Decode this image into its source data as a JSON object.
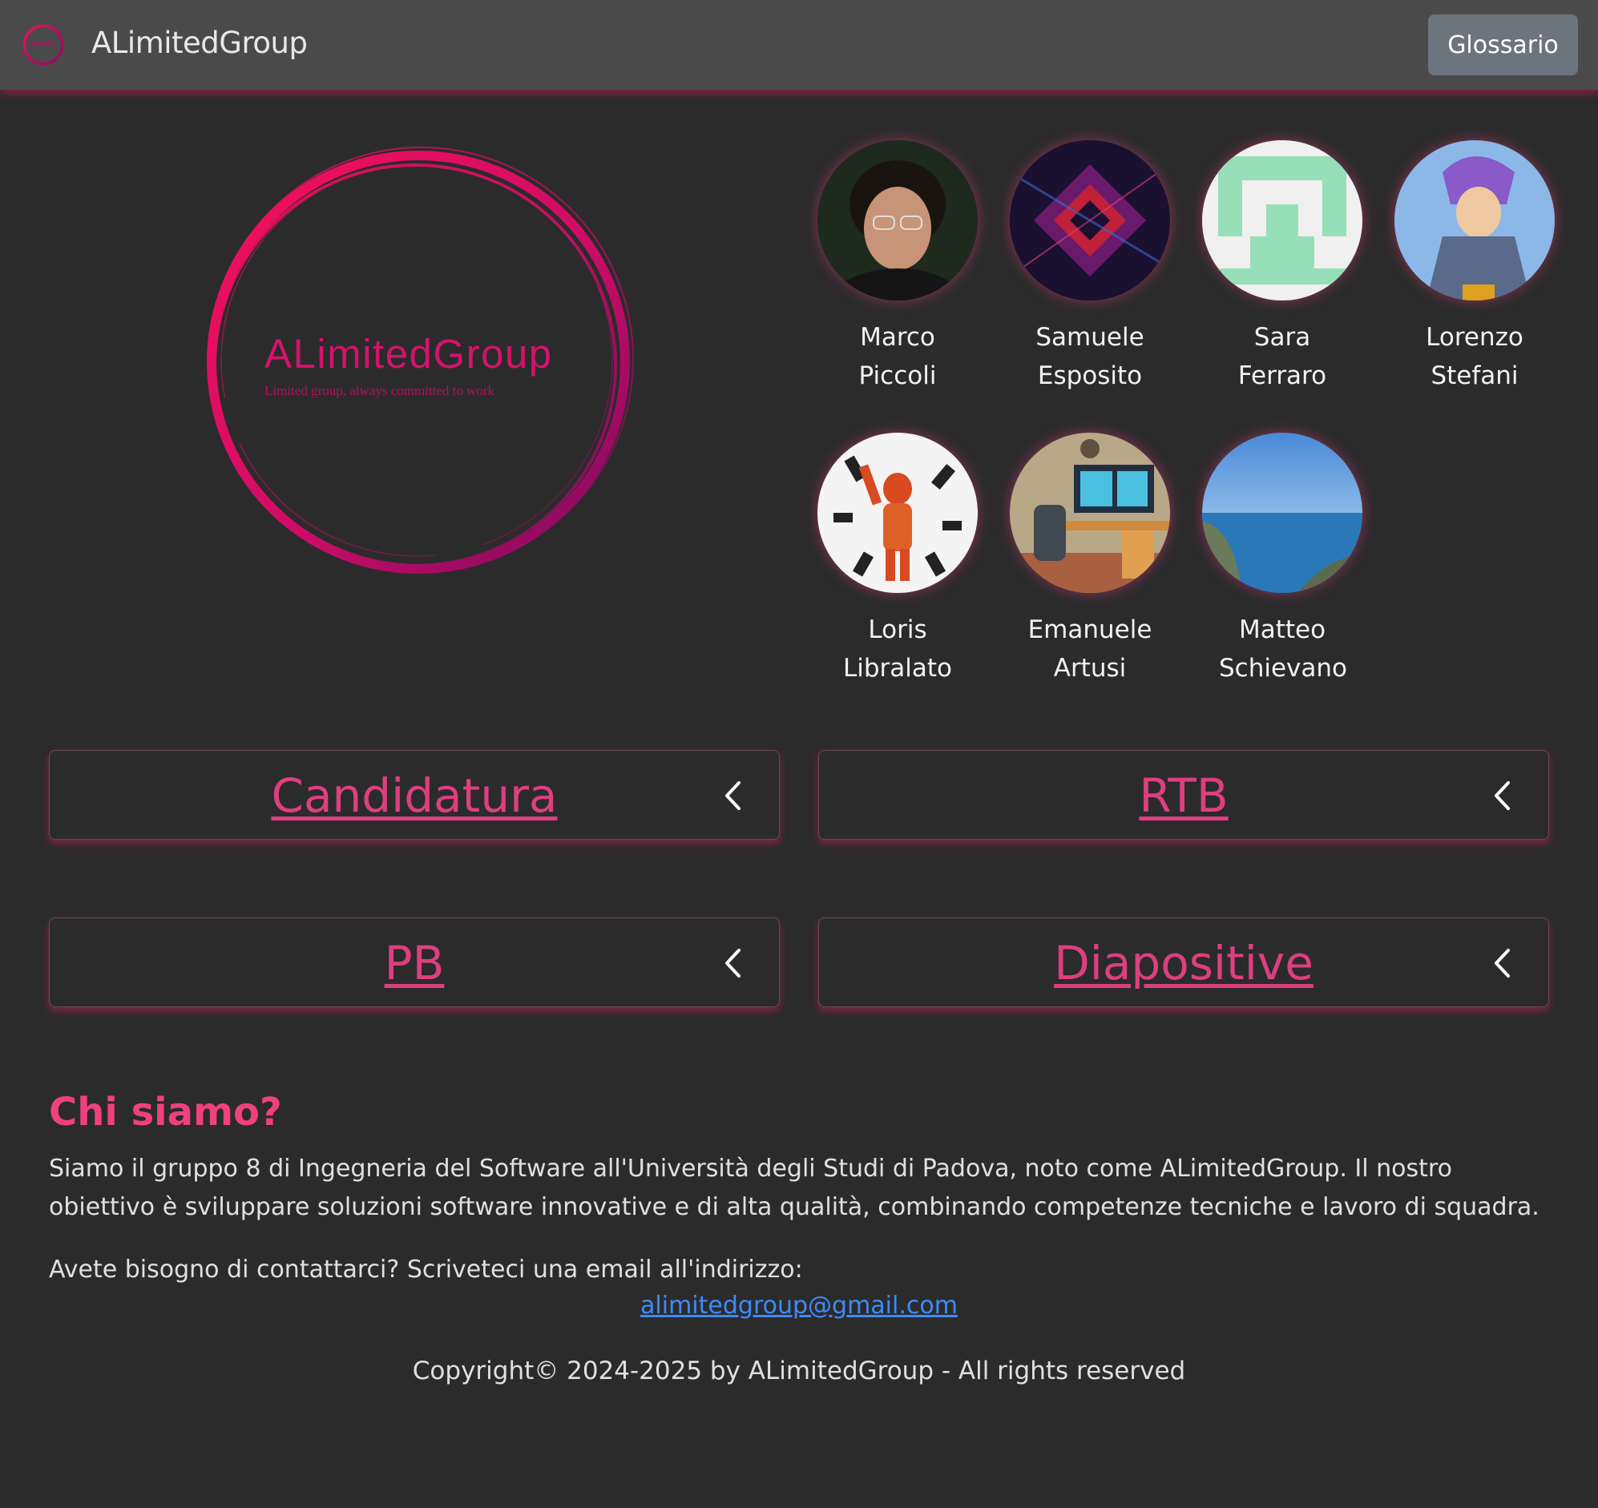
{
  "navbar": {
    "title": "ALimitedGroup",
    "glossary_label": "Glossario"
  },
  "logo": {
    "name": "ALimitedGroup",
    "tagline": "Limited group, always committed to work"
  },
  "team": [
    {
      "first": "Marco",
      "last": "Piccoli",
      "avatar": "portrait-photo"
    },
    {
      "first": "Samuele",
      "last": "Esposito",
      "avatar": "abstract-cube-art"
    },
    {
      "first": "Sara Ferraro",
      "last": "",
      "avatar": "identicon-green"
    },
    {
      "first": "Lorenzo",
      "last": "Stefani",
      "avatar": "anime-character"
    },
    {
      "first": "Loris",
      "last": "Libralato",
      "avatar": "astronaut-art"
    },
    {
      "first": "Emanuele",
      "last": "Artusi",
      "avatar": "desk-setup-art"
    },
    {
      "first": "Matteo",
      "last": "Schievano",
      "avatar": "coastline-photo"
    }
  ],
  "cards": [
    {
      "label": "Candidatura",
      "icon": "chevron-left-icon"
    },
    {
      "label": "RTB",
      "icon": "chevron-left-icon"
    },
    {
      "label": "PB",
      "icon": "chevron-left-icon"
    },
    {
      "label": "Diapositive",
      "icon": "chevron-left-icon"
    }
  ],
  "about": {
    "heading": "Chi siamo?",
    "text": "Siamo il gruppo 8 di Ingegneria del Software all'Università degli Studi di Padova, noto come ALimitedGroup. Il nostro obiettivo è sviluppare soluzioni software innovative e di alta qualità, combinando competenze tecniche e lavoro di squadra.",
    "contact": "Avete bisogno di contattarci? Scriveteci una email all'indirizzo:",
    "email": "alimitedgroup@gmail.com"
  },
  "footer": {
    "copyright": "Copyright© 2024-2025 by ALimitedGroup - All rights reserved"
  },
  "colors": {
    "accent": "#de3f7e",
    "background": "#2b2b2c",
    "navbar": "#4a4a4b",
    "link": "#3d8bfd"
  }
}
